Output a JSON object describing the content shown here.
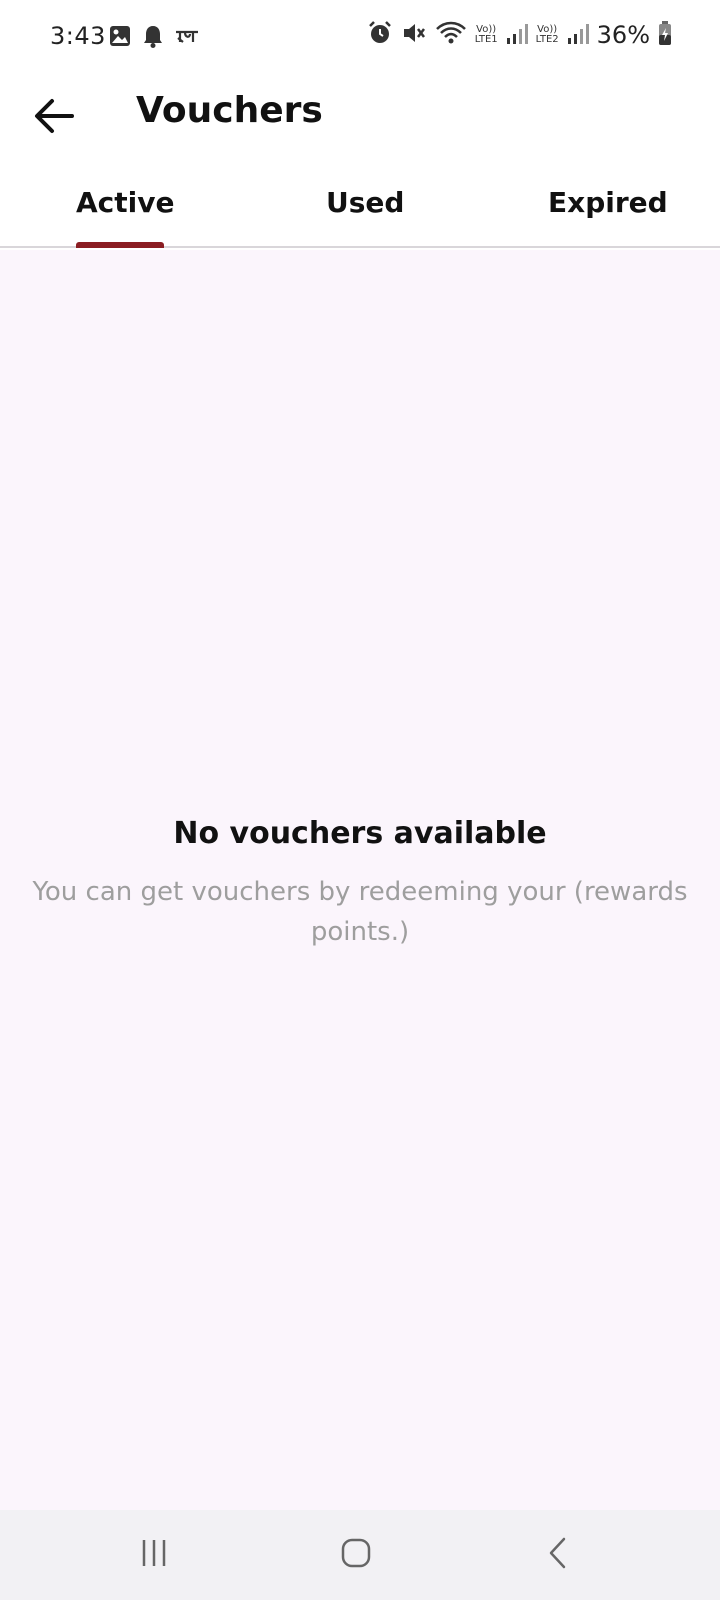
{
  "status_bar": {
    "time": "3:43",
    "battery": "36%",
    "icons": [
      "gallery-icon",
      "notification-bell-icon",
      "app-notification-icon",
      "alarm-icon",
      "mute-icon",
      "wifi-icon",
      "signal-lte1-icon",
      "signal-lte2-icon",
      "battery-charging-icon"
    ],
    "lte1_top": "Vo))",
    "lte1_bottom": "LTE1",
    "lte2_top": "Vo))",
    "lte2_bottom": "LTE2"
  },
  "app_bar": {
    "title": "Vouchers",
    "back_icon": "back-arrow-icon"
  },
  "tabs": [
    {
      "label": "Active",
      "selected": true
    },
    {
      "label": "Used",
      "selected": false
    },
    {
      "label": "Expired",
      "selected": false
    }
  ],
  "empty_state": {
    "title": "No vouchers available",
    "message": "You can get vouchers by redeeming your (rewards points.)"
  },
  "nav_bar": {
    "icons": [
      "recent-apps-icon",
      "home-icon",
      "back-icon"
    ]
  },
  "colors": {
    "accent": "#8a1d22",
    "content_background": "#fbf5fc",
    "muted_text": "#9e9e9e"
  }
}
